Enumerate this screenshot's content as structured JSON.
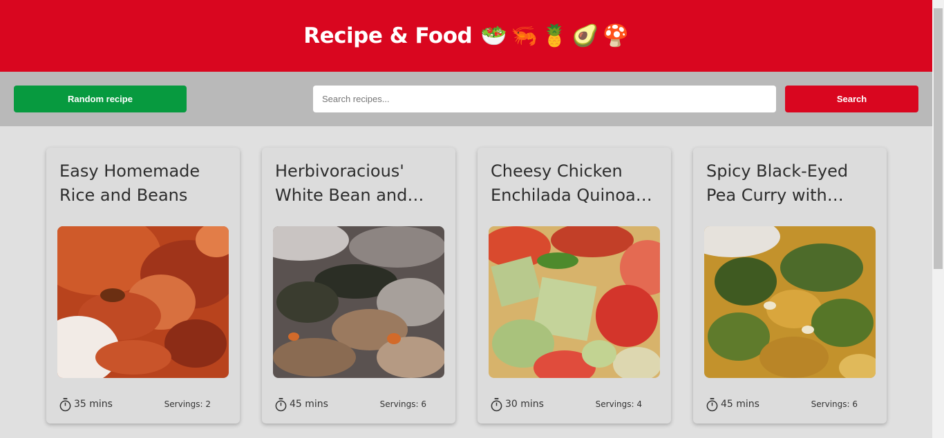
{
  "header": {
    "title": "Recipe & Food",
    "emojis": [
      "🥗",
      "🦐",
      "🍍",
      "🥑",
      "🍄"
    ],
    "color": "#d9061f"
  },
  "toolbar": {
    "random_label": "Random recipe",
    "search_placeholder": "Search recipes...",
    "search_label": "Search",
    "random_color": "#079a3f",
    "search_color": "#d9061f"
  },
  "cards": [
    {
      "title": "Easy Homemade Rice and Beans",
      "time": "35 mins",
      "servings": "Servings: 2",
      "image_icon": "rice-and-beans-photo"
    },
    {
      "title": "Herbivoracious' White Bean and Kale Soup",
      "time": "45 mins",
      "servings": "Servings: 6",
      "image_icon": "bean-kale-soup-photo"
    },
    {
      "title": "Cheesy Chicken Enchilada Quinoa Casserole",
      "time": "30 mins",
      "servings": "Servings: 4",
      "image_icon": "quinoa-casserole-photo"
    },
    {
      "title": "Spicy Black-Eyed Pea Curry with Swiss Chard",
      "time": "45 mins",
      "servings": "Servings: 6",
      "image_icon": "black-eyed-pea-curry-photo"
    }
  ]
}
